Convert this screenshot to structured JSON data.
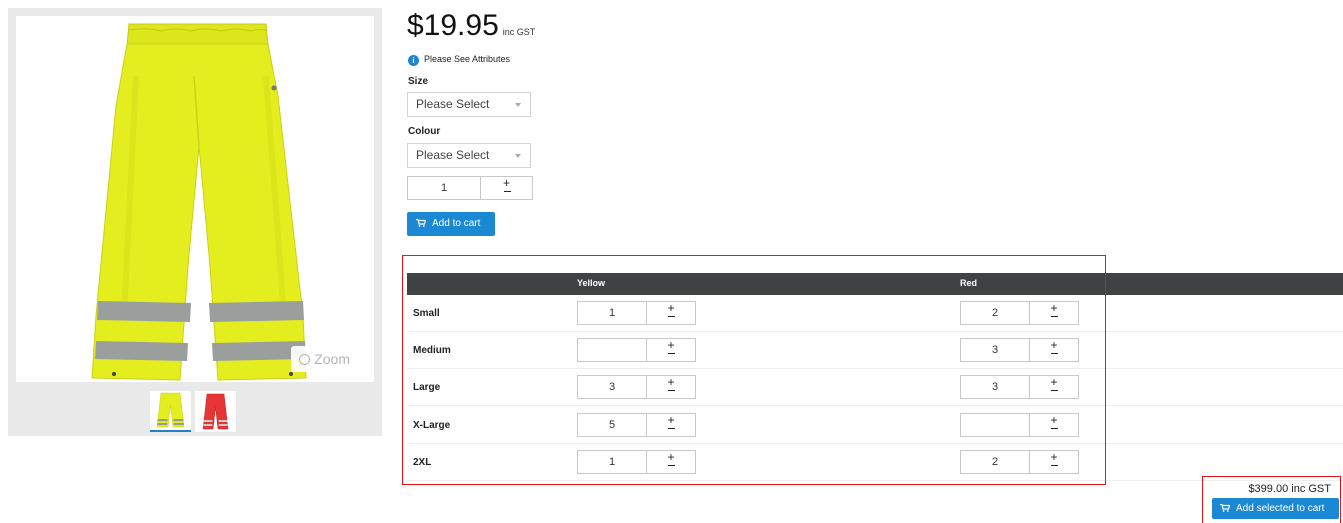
{
  "product": {
    "price": "$19.95",
    "price_suffix": "inc GST",
    "info_text": "Please See Attributes",
    "zoom_label": "Zoom"
  },
  "options": {
    "size_label": "Size",
    "size_value": "Please Select",
    "colour_label": "Colour",
    "colour_value": "Please Select",
    "quantity": "1",
    "add_to_cart_label": "Add to cart"
  },
  "grid": {
    "columns": [
      "Yellow",
      "Red"
    ],
    "rows": [
      {
        "size": "Small",
        "yellow": "1",
        "red": "2"
      },
      {
        "size": "Medium",
        "yellow": "",
        "red": "3"
      },
      {
        "size": "Large",
        "yellow": "3",
        "red": "3"
      },
      {
        "size": "X-Large",
        "yellow": "5",
        "red": ""
      },
      {
        "size": "2XL",
        "yellow": "1",
        "red": "2"
      }
    ]
  },
  "summary": {
    "total": "$399.00 inc GST",
    "add_selected_label": "Add selected to cart"
  },
  "colors": {
    "accent": "#1b88d4",
    "header": "#3e4243",
    "highlight": "#e0161a",
    "hivis_yellow": "#e6f01e",
    "hivis_red": "#e53535"
  }
}
